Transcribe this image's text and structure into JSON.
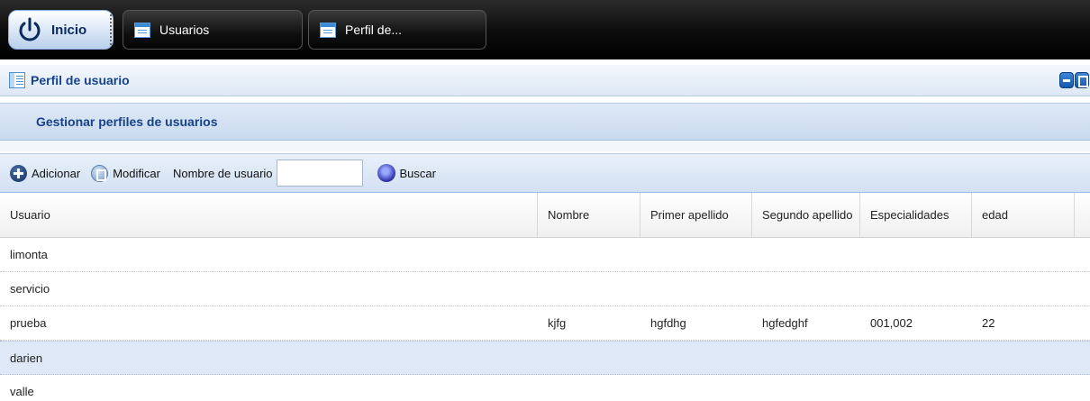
{
  "taskbar": {
    "start_label": "Inicio",
    "tasks": [
      {
        "label": "Usuarios",
        "icon": "window-icon"
      },
      {
        "label": "Perfil de...",
        "icon": "window-icon"
      }
    ]
  },
  "panel": {
    "title": "Perfil de usuario",
    "section_title": "Gestionar perfiles de usuarios"
  },
  "toolbar": {
    "add_label": "Adicionar",
    "edit_label": "Modificar",
    "username_label": "Nombre de usuario",
    "username_value": "",
    "search_label": "Buscar"
  },
  "grid": {
    "columns": [
      "Usuario",
      "Nombre",
      "Primer apellido",
      "Segundo apellido",
      "Especialidades",
      "edad"
    ],
    "rows": [
      {
        "usuario": "limonta",
        "nombre": "",
        "primer_apellido": "",
        "segundo_apellido": "",
        "especialidades": "",
        "edad": ""
      },
      {
        "usuario": "servicio",
        "nombre": "",
        "primer_apellido": "",
        "segundo_apellido": "",
        "especialidades": "",
        "edad": ""
      },
      {
        "usuario": "prueba",
        "nombre": "kjfg",
        "primer_apellido": "hgfdhg",
        "segundo_apellido": "hgfedghf",
        "especialidades": "001,002",
        "edad": "22"
      },
      {
        "usuario": "darien",
        "nombre": "",
        "primer_apellido": "",
        "segundo_apellido": "",
        "especialidades": "",
        "edad": ""
      },
      {
        "usuario": "valle",
        "nombre": "",
        "primer_apellido": "",
        "segundo_apellido": "",
        "especialidades": "",
        "edad": ""
      }
    ],
    "selected_row": "darien"
  },
  "colors": {
    "accent": "#15428b",
    "selection": "#dfe8f6",
    "taskbar": "#0c0c0c"
  }
}
